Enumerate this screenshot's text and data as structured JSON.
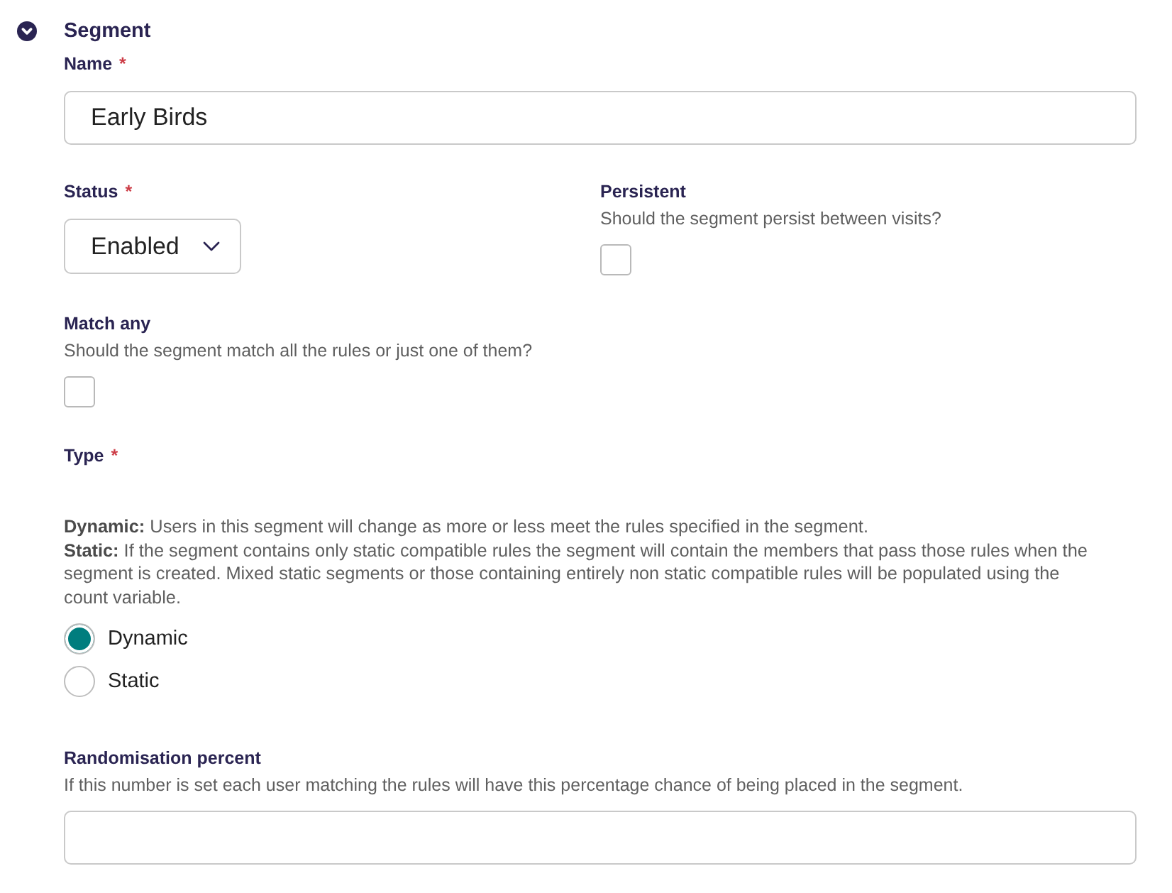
{
  "section": {
    "title": "Segment",
    "expanded": true
  },
  "name": {
    "label": "Name",
    "required_mark": "*",
    "value": "Early Birds"
  },
  "status": {
    "label": "Status",
    "required_mark": "*",
    "value": "Enabled"
  },
  "persistent": {
    "label": "Persistent",
    "help": "Should the segment persist between visits?",
    "checked": false
  },
  "match_any": {
    "label": "Match any",
    "help": "Should the segment match all the rules or just one of them?",
    "checked": false
  },
  "type": {
    "label": "Type",
    "required_mark": "*",
    "descriptions": [
      "**Dynamic:** Users in this segment will change as more or less meet the rules specified in the segment.",
      "**Static:** If the segment contains only static compatible rules the segment will contain the members that pass those rules when the segment is created. Mixed static segments or those containing entirely non static compatible rules will be populated using the count variable."
    ],
    "options": [
      {
        "label": "Dynamic",
        "selected": true
      },
      {
        "label": "Static",
        "selected": false
      }
    ]
  },
  "randomisation": {
    "label": "Randomisation percent",
    "help": "If this number is set each user matching the rules will have this percentage chance of being placed in the segment."
  }
}
